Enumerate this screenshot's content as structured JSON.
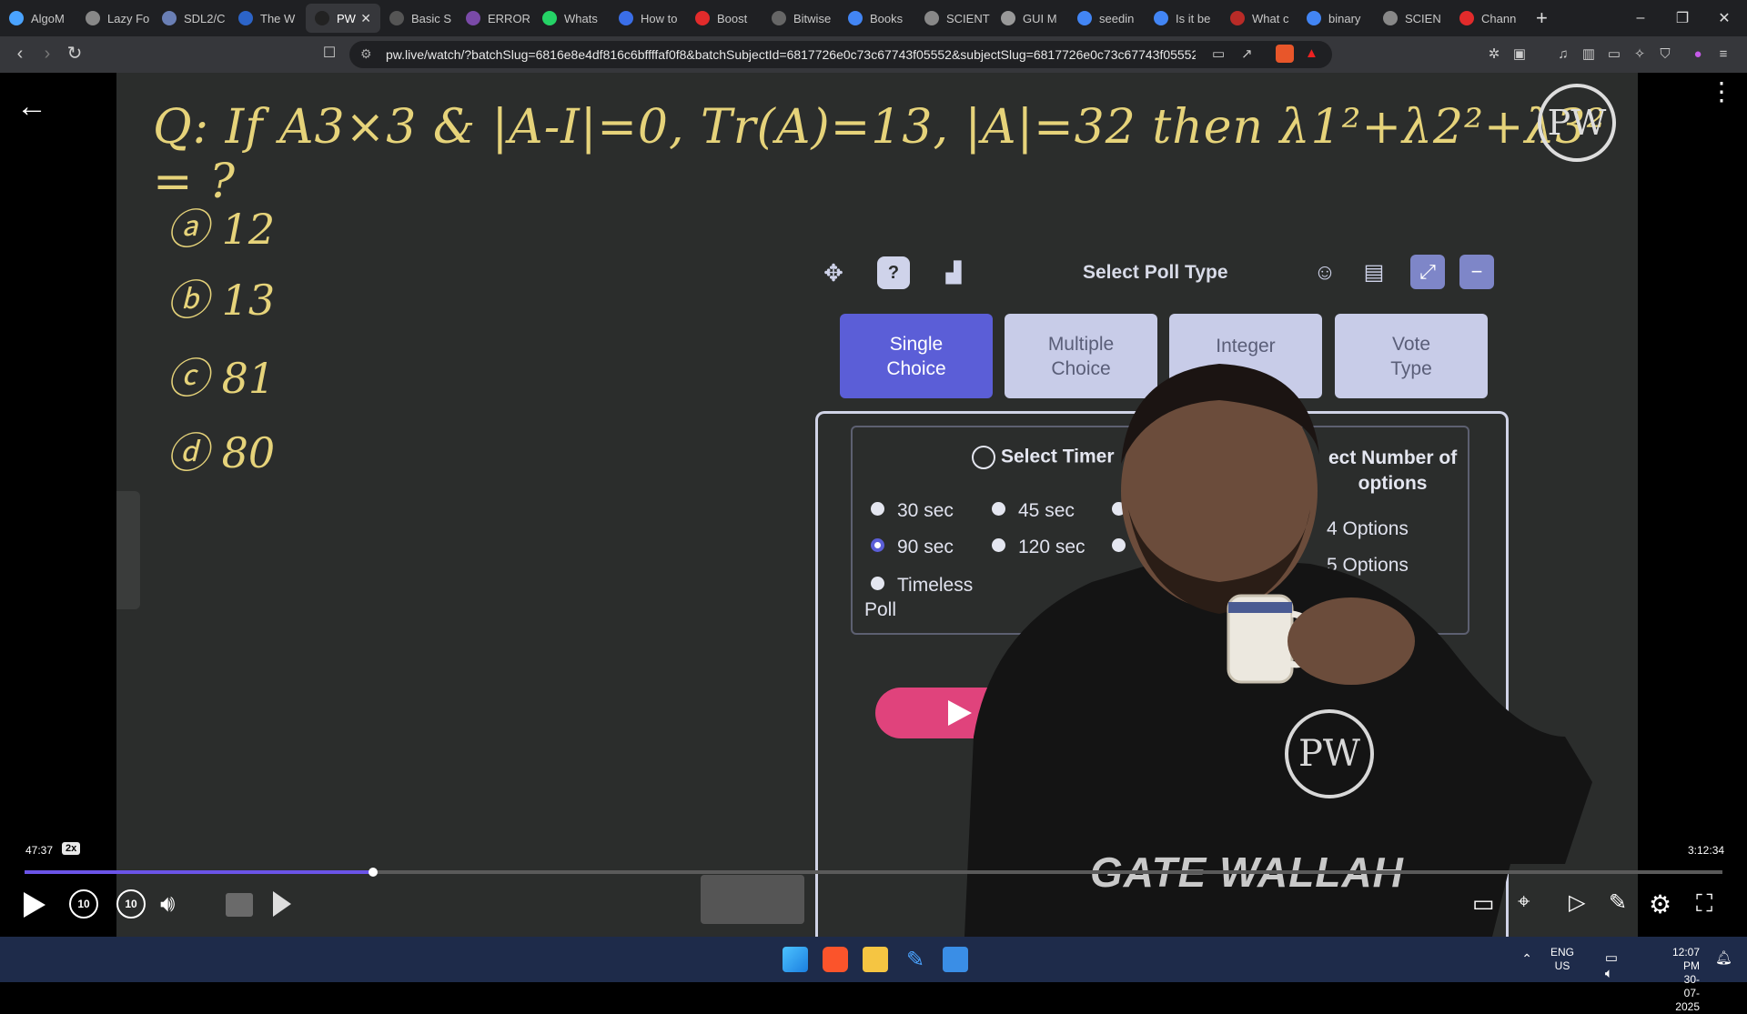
{
  "browser": {
    "tabs": [
      {
        "label": "AlgoM",
        "color": "#4aa3ff",
        "active": false
      },
      {
        "label": "Lazy Fo",
        "color": "#888888",
        "active": false
      },
      {
        "label": "SDL2/C",
        "color": "#6a7fb5",
        "active": false
      },
      {
        "label": "The W",
        "color": "#2c64c8",
        "active": false
      },
      {
        "label": "PW",
        "color": "#222222",
        "active": true
      },
      {
        "label": "Basic S",
        "color": "#555555",
        "active": false
      },
      {
        "label": "ERROR",
        "color": "#7a4aa8",
        "active": false
      },
      {
        "label": "Whats",
        "color": "#25d366",
        "active": false
      },
      {
        "label": "How to",
        "color": "#3a6ee8",
        "active": false
      },
      {
        "label": "Boost",
        "color": "#e22b2b",
        "active": false
      },
      {
        "label": "Bitwise",
        "color": "#666666",
        "active": false
      },
      {
        "label": "Books",
        "color": "#4285f4",
        "active": false
      },
      {
        "label": "SCIENT",
        "color": "#888888",
        "active": false
      },
      {
        "label": "GUI M",
        "color": "#999999",
        "active": false
      },
      {
        "label": "seedin",
        "color": "#4285f4",
        "active": false
      },
      {
        "label": "Is it be",
        "color": "#4285f4",
        "active": false
      },
      {
        "label": "What c",
        "color": "#b92b27",
        "active": false
      },
      {
        "label": "binary",
        "color": "#4285f4",
        "active": false
      },
      {
        "label": "SCIEN",
        "color": "#888888",
        "active": false
      },
      {
        "label": "Chann",
        "color": "#e22b2b",
        "active": false
      }
    ],
    "new_tab": "+",
    "url": "pw.live/watch/?batchSlug=6816e8e4df816c6bffffaf0f8&batchSubjectId=6817726e0c73c67743f05552&subjectSlug=6817726e0c73c67743f05552...",
    "window_controls": {
      "minimize": "–",
      "restore": "❐",
      "close": "✕"
    }
  },
  "lecture": {
    "question": "Q: If A3×3 & |A-I|=0, Tr(A)=13, |A|=32 then λ1²+λ2²+λ3² = ?",
    "options": [
      {
        "label": "ⓐ",
        "value": "12"
      },
      {
        "label": "ⓑ",
        "value": "13"
      },
      {
        "label": "ⓒ",
        "value": "81"
      },
      {
        "label": "ⓓ",
        "value": "80"
      }
    ],
    "logo_text": "PW",
    "shirt_text": "GATE WALLAH"
  },
  "poll": {
    "title": "Select Poll Type",
    "types": [
      {
        "label_line1": "Single",
        "label_line2": "Choice",
        "selected": true
      },
      {
        "label_line1": "Multiple",
        "label_line2": "Choice",
        "selected": false
      },
      {
        "label_line1": "Integer",
        "label_line2": "",
        "selected": false
      },
      {
        "label_line1": "Vote",
        "label_line2": "Type",
        "selected": false
      }
    ],
    "timer_heading": "Select Timer",
    "timers": [
      {
        "label": "30 sec",
        "selected": false
      },
      {
        "label": "45 sec",
        "selected": false
      },
      {
        "label": "90 sec",
        "selected": true
      },
      {
        "label": "120 sec",
        "selected": false
      },
      {
        "label": "Timeless",
        "label2": "Poll",
        "selected": false
      }
    ],
    "options_heading_line1": "ect Number of",
    "options_heading_line2": "options",
    "option_counts": [
      "4 Options",
      "5 Options"
    ],
    "accent": "#5b5ed7",
    "start_color": "#e0437c"
  },
  "player": {
    "current_time": "47:37",
    "speed": "2x",
    "duration": "3:12:34",
    "progress_fraction": 0.205,
    "skip_back": "10",
    "skip_forward": "10"
  },
  "taskbar": {
    "lang_line1": "ENG",
    "lang_line2": "US",
    "time": "12:07 PM",
    "date": "30-07-2025"
  }
}
